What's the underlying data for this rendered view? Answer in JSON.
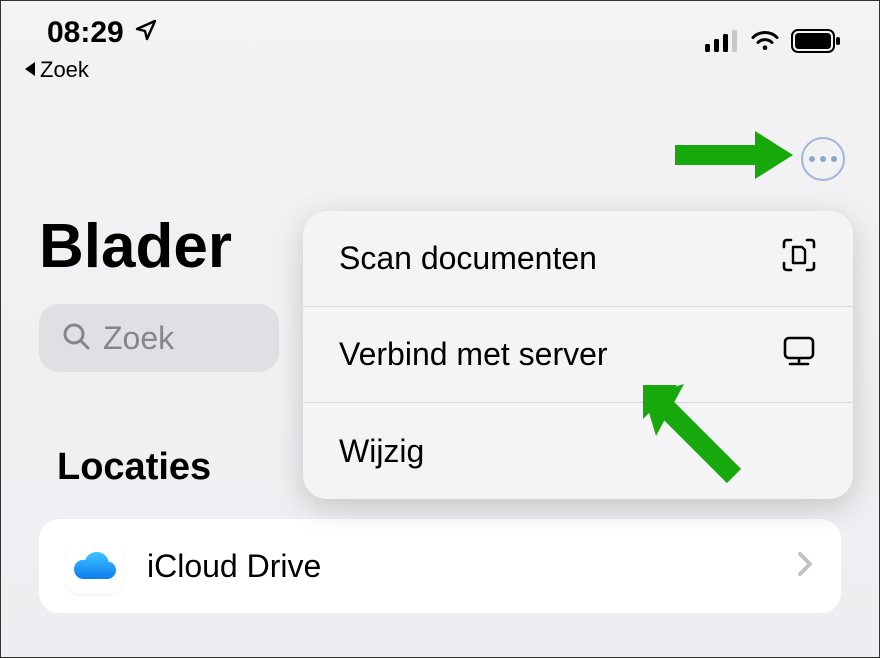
{
  "status": {
    "time": "08:29",
    "back_label": "Zoek"
  },
  "page_title": "Blader",
  "search": {
    "placeholder": "Zoek"
  },
  "section_header": "Locaties",
  "list": {
    "items": [
      {
        "label": "iCloud Drive"
      }
    ]
  },
  "popover": {
    "items": [
      {
        "label": "Scan documenten"
      },
      {
        "label": "Verbind met server"
      },
      {
        "label": "Wijzig"
      }
    ]
  }
}
